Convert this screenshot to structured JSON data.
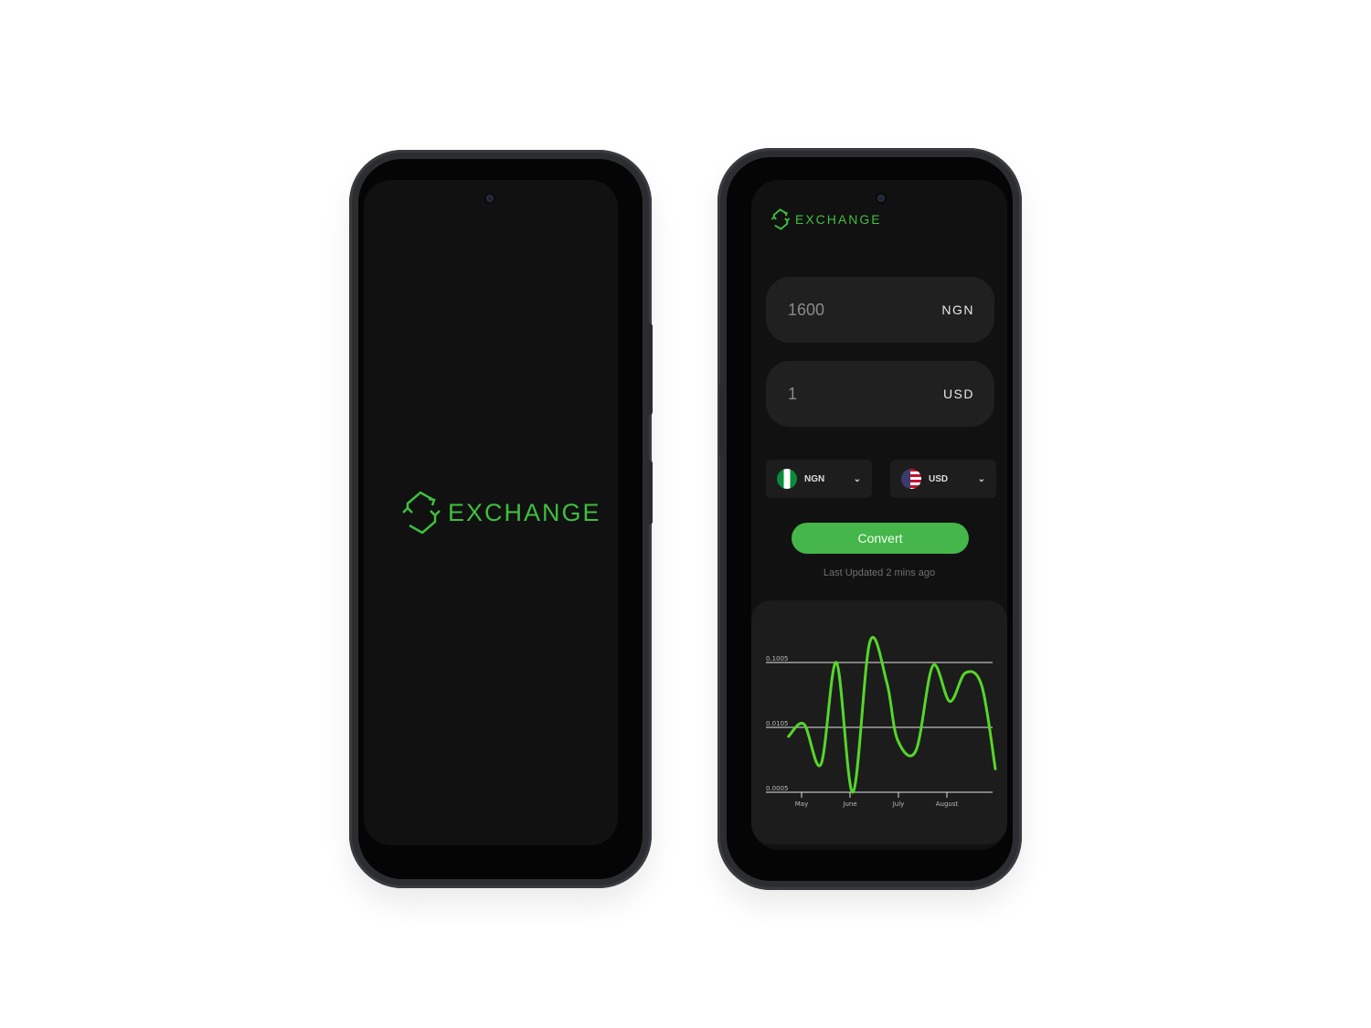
{
  "app": {
    "name": "EXCHANGE",
    "accent": "#45b649"
  },
  "splash": {
    "logo_text": "EXCHANGE"
  },
  "converter": {
    "header_logo": "EXCHANGE",
    "from_field": {
      "value": "1600",
      "currency": "NGN"
    },
    "to_field": {
      "value": "1",
      "currency": "USD"
    },
    "from_select": {
      "label": "NGN",
      "flag": "nigeria-flag-icon"
    },
    "to_select": {
      "label": "USD",
      "flag": "us-flag-icon"
    },
    "convert_label": "Convert",
    "last_updated": "Last Updated 2 mins ago"
  },
  "chart_data": {
    "type": "line",
    "title": "",
    "xlabel": "",
    "ylabel": "",
    "x_ticks": [
      "May",
      "June",
      "July",
      "August"
    ],
    "y_ticks": [
      "0.0005",
      "0.0105",
      "0.1005"
    ],
    "y_tick_values": [
      0.0005,
      0.0105,
      0.1005
    ],
    "y_scale": "piecewise, ticks evenly spaced",
    "grid": true,
    "color": "#55d62a",
    "x": [
      -0.27,
      0.05,
      0.4,
      0.72,
      1.06,
      1.41,
      1.76,
      1.98,
      2.36,
      2.71,
      3.06,
      3.38,
      3.72,
      4.0
    ],
    "values": [
      0.0091,
      0.015,
      0.0048,
      0.1005,
      0.0005,
      0.1293,
      0.0726,
      0.0086,
      0.0069,
      0.096,
      0.0465,
      0.0861,
      0.0681,
      0.0041
    ]
  }
}
